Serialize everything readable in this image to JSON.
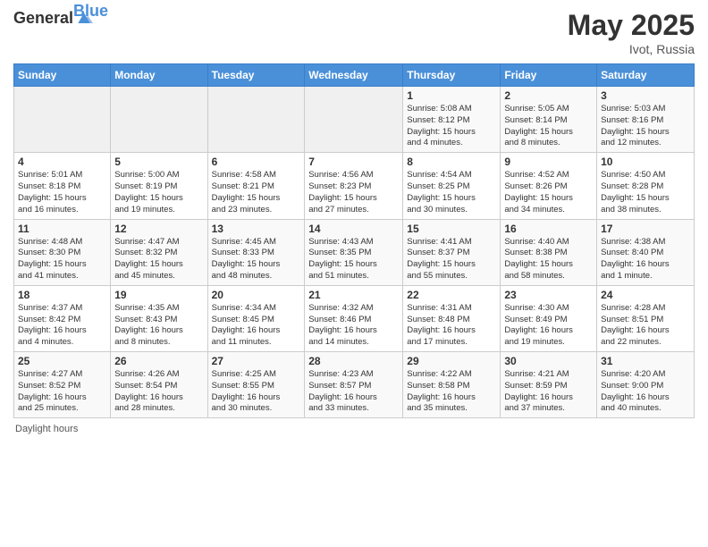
{
  "header": {
    "logo_general": "General",
    "logo_blue": "Blue",
    "month_year": "May 2025",
    "location": "Ivot, Russia"
  },
  "days_of_week": [
    "Sunday",
    "Monday",
    "Tuesday",
    "Wednesday",
    "Thursday",
    "Friday",
    "Saturday"
  ],
  "footer": {
    "daylight_hours": "Daylight hours"
  },
  "weeks": [
    {
      "days": [
        {
          "num": "",
          "info": "",
          "empty": true
        },
        {
          "num": "",
          "info": "",
          "empty": true
        },
        {
          "num": "",
          "info": "",
          "empty": true
        },
        {
          "num": "",
          "info": "",
          "empty": true
        },
        {
          "num": "1",
          "info": "Sunrise: 5:08 AM\nSunset: 8:12 PM\nDaylight: 15 hours\nand 4 minutes."
        },
        {
          "num": "2",
          "info": "Sunrise: 5:05 AM\nSunset: 8:14 PM\nDaylight: 15 hours\nand 8 minutes."
        },
        {
          "num": "3",
          "info": "Sunrise: 5:03 AM\nSunset: 8:16 PM\nDaylight: 15 hours\nand 12 minutes."
        }
      ]
    },
    {
      "days": [
        {
          "num": "4",
          "info": "Sunrise: 5:01 AM\nSunset: 8:18 PM\nDaylight: 15 hours\nand 16 minutes."
        },
        {
          "num": "5",
          "info": "Sunrise: 5:00 AM\nSunset: 8:19 PM\nDaylight: 15 hours\nand 19 minutes."
        },
        {
          "num": "6",
          "info": "Sunrise: 4:58 AM\nSunset: 8:21 PM\nDaylight: 15 hours\nand 23 minutes."
        },
        {
          "num": "7",
          "info": "Sunrise: 4:56 AM\nSunset: 8:23 PM\nDaylight: 15 hours\nand 27 minutes."
        },
        {
          "num": "8",
          "info": "Sunrise: 4:54 AM\nSunset: 8:25 PM\nDaylight: 15 hours\nand 30 minutes."
        },
        {
          "num": "9",
          "info": "Sunrise: 4:52 AM\nSunset: 8:26 PM\nDaylight: 15 hours\nand 34 minutes."
        },
        {
          "num": "10",
          "info": "Sunrise: 4:50 AM\nSunset: 8:28 PM\nDaylight: 15 hours\nand 38 minutes."
        }
      ]
    },
    {
      "days": [
        {
          "num": "11",
          "info": "Sunrise: 4:48 AM\nSunset: 8:30 PM\nDaylight: 15 hours\nand 41 minutes."
        },
        {
          "num": "12",
          "info": "Sunrise: 4:47 AM\nSunset: 8:32 PM\nDaylight: 15 hours\nand 45 minutes."
        },
        {
          "num": "13",
          "info": "Sunrise: 4:45 AM\nSunset: 8:33 PM\nDaylight: 15 hours\nand 48 minutes."
        },
        {
          "num": "14",
          "info": "Sunrise: 4:43 AM\nSunset: 8:35 PM\nDaylight: 15 hours\nand 51 minutes."
        },
        {
          "num": "15",
          "info": "Sunrise: 4:41 AM\nSunset: 8:37 PM\nDaylight: 15 hours\nand 55 minutes."
        },
        {
          "num": "16",
          "info": "Sunrise: 4:40 AM\nSunset: 8:38 PM\nDaylight: 15 hours\nand 58 minutes."
        },
        {
          "num": "17",
          "info": "Sunrise: 4:38 AM\nSunset: 8:40 PM\nDaylight: 16 hours\nand 1 minute."
        }
      ]
    },
    {
      "days": [
        {
          "num": "18",
          "info": "Sunrise: 4:37 AM\nSunset: 8:42 PM\nDaylight: 16 hours\nand 4 minutes."
        },
        {
          "num": "19",
          "info": "Sunrise: 4:35 AM\nSunset: 8:43 PM\nDaylight: 16 hours\nand 8 minutes."
        },
        {
          "num": "20",
          "info": "Sunrise: 4:34 AM\nSunset: 8:45 PM\nDaylight: 16 hours\nand 11 minutes."
        },
        {
          "num": "21",
          "info": "Sunrise: 4:32 AM\nSunset: 8:46 PM\nDaylight: 16 hours\nand 14 minutes."
        },
        {
          "num": "22",
          "info": "Sunrise: 4:31 AM\nSunset: 8:48 PM\nDaylight: 16 hours\nand 17 minutes."
        },
        {
          "num": "23",
          "info": "Sunrise: 4:30 AM\nSunset: 8:49 PM\nDaylight: 16 hours\nand 19 minutes."
        },
        {
          "num": "24",
          "info": "Sunrise: 4:28 AM\nSunset: 8:51 PM\nDaylight: 16 hours\nand 22 minutes."
        }
      ]
    },
    {
      "days": [
        {
          "num": "25",
          "info": "Sunrise: 4:27 AM\nSunset: 8:52 PM\nDaylight: 16 hours\nand 25 minutes."
        },
        {
          "num": "26",
          "info": "Sunrise: 4:26 AM\nSunset: 8:54 PM\nDaylight: 16 hours\nand 28 minutes."
        },
        {
          "num": "27",
          "info": "Sunrise: 4:25 AM\nSunset: 8:55 PM\nDaylight: 16 hours\nand 30 minutes."
        },
        {
          "num": "28",
          "info": "Sunrise: 4:23 AM\nSunset: 8:57 PM\nDaylight: 16 hours\nand 33 minutes."
        },
        {
          "num": "29",
          "info": "Sunrise: 4:22 AM\nSunset: 8:58 PM\nDaylight: 16 hours\nand 35 minutes."
        },
        {
          "num": "30",
          "info": "Sunrise: 4:21 AM\nSunset: 8:59 PM\nDaylight: 16 hours\nand 37 minutes."
        },
        {
          "num": "31",
          "info": "Sunrise: 4:20 AM\nSunset: 9:00 PM\nDaylight: 16 hours\nand 40 minutes."
        }
      ]
    }
  ]
}
